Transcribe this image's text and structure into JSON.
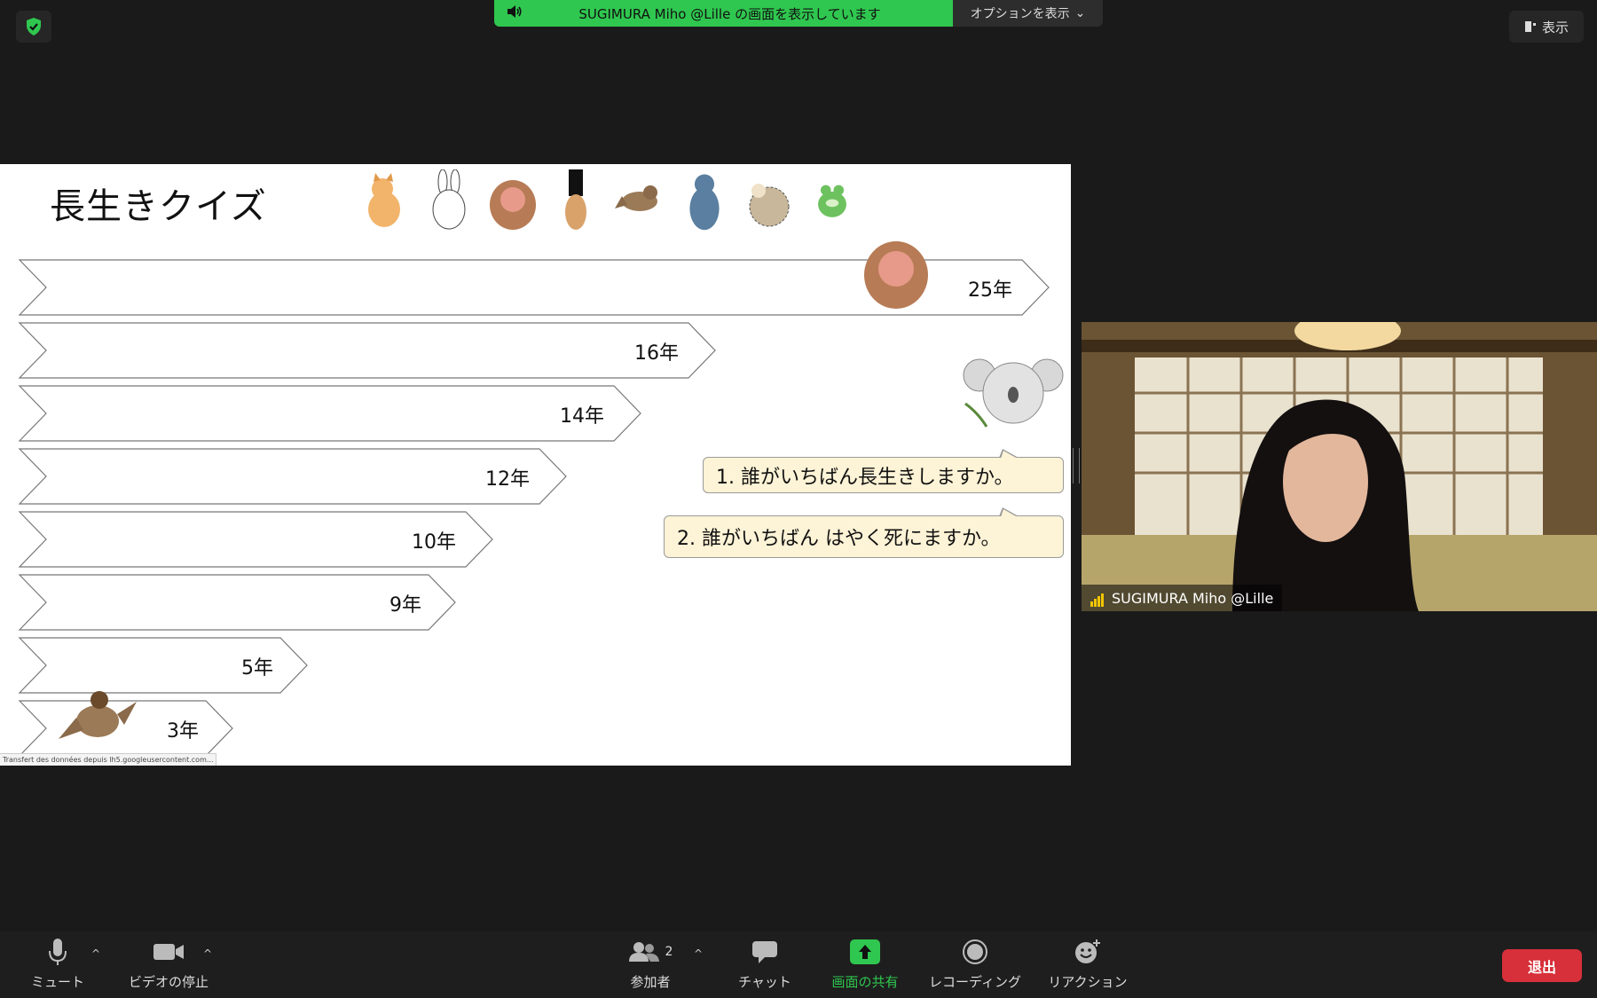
{
  "top": {
    "share_banner": "SUGIMURA Miho @Lille の画面を表示しています",
    "options_label": "オプションを表示",
    "view_label": "表示"
  },
  "slide": {
    "title": "長生きクイズ",
    "bars": [
      {
        "label": "25年",
        "years": 25
      },
      {
        "label": "16年",
        "years": 16
      },
      {
        "label": "14年",
        "years": 14
      },
      {
        "label": "12年",
        "years": 12
      },
      {
        "label": "10年",
        "years": 10
      },
      {
        "label": "9年",
        "years": 9
      },
      {
        "label": "5年",
        "years": 5
      },
      {
        "label": "3年",
        "years": 3
      }
    ],
    "question1": "1. 誰がいちばん長生きしますか。",
    "question2": "2. 誰がいちばん はやく死にますか。",
    "status_text": "Transfert des données depuis lh5.googleusercontent.com...",
    "animal_icons": [
      "fox-icon",
      "rabbit-icon",
      "monkey-icon",
      "cat-icon",
      "sparrow-icon",
      "wolf-icon",
      "hedgehog-icon",
      "frog-icon",
      "koala-icon"
    ]
  },
  "video": {
    "participant_name": "SUGIMURA Miho @Lille"
  },
  "toolbar": {
    "mute": "ミュート",
    "stop_video": "ビデオの停止",
    "participants": "参加者",
    "participants_count": "2",
    "chat": "チャット",
    "share_screen": "画面の共有",
    "recording": "レコーディング",
    "reactions": "リアクション",
    "leave": "退出"
  },
  "colors": {
    "share_green": "#2fc74f",
    "leave_red": "#d7303a",
    "question_bg": "#fdf3d6"
  }
}
